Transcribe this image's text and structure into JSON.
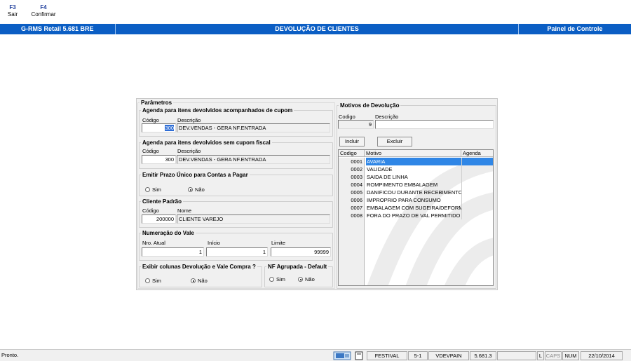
{
  "toolbar": {
    "f3": {
      "key": "F3",
      "label": "Sair"
    },
    "f4": {
      "key": "F4",
      "label": "Confirmar"
    }
  },
  "titlebar": {
    "app": "G-RMS Retail 5.681 BRE",
    "screen": "DEVOLUÇÃO DE CLIENTES",
    "panel": "Painel de Controle"
  },
  "params": {
    "title": "Parâmetros",
    "agenda_cupom": {
      "title": "Agenda para itens devolvidos acompanhados de cupom",
      "codigo_label": "Código",
      "descricao_label": "Descrição",
      "codigo": "300",
      "descricao": "DEV.VENDAS - GERA NF.ENTRADA"
    },
    "agenda_sem_cupom": {
      "title": "Agenda para itens devolvidos sem cupom fiscal",
      "codigo_label": "Código",
      "descricao_label": "Descrição",
      "codigo": "300",
      "descricao": "DEV.VENDAS - GERA NF.ENTRADA"
    },
    "prazo_unico": {
      "title": "Emitir Prazo Único para Contas a Pagar",
      "sim": "Sim",
      "nao": "Não",
      "selected": "nao"
    },
    "cliente_padrao": {
      "title": "Cliente Padrão",
      "codigo_label": "Código",
      "nome_label": "Nome",
      "codigo": "200000",
      "nome": "CLIENTE VAREJO"
    },
    "numeracao_vale": {
      "title": "Numeração do Vale",
      "atual_label": "Nro. Atual",
      "inicio_label": "Início",
      "limite_label": "Limite",
      "atual": "1",
      "inicio": "1",
      "limite": "99999"
    },
    "exibir_colunas": {
      "title": "Exibir colunas Devolução e Vale Compra ?",
      "sim": "Sim",
      "nao": "Não",
      "selected": "nao"
    },
    "nf_agrupada": {
      "title": "NF Agrupada - Default",
      "sim": "Sim",
      "nao": "Não",
      "selected": "nao"
    }
  },
  "motivos": {
    "title": "Motivos de Devolução",
    "codigo_label": "Codigo",
    "descricao_label": "Descrição",
    "codigo": "9",
    "descricao": "",
    "incluir": "Incluir",
    "excluir": "Excluir",
    "columns": [
      "Codigo",
      "Motivo",
      "Agenda"
    ],
    "rows": [
      {
        "codigo": "0001",
        "motivo": "AVARIA",
        "agenda": ""
      },
      {
        "codigo": "0002",
        "motivo": "VALIDADE",
        "agenda": ""
      },
      {
        "codigo": "0003",
        "motivo": "SAIDA DE LINHA",
        "agenda": ""
      },
      {
        "codigo": "0004",
        "motivo": "ROMPIMENTO EMBALAGEM",
        "agenda": ""
      },
      {
        "codigo": "0005",
        "motivo": "DANIFICOU DURANTE RECEBIMENTO",
        "agenda": ""
      },
      {
        "codigo": "0006",
        "motivo": "IMPROPRIO PARA CONSUMO",
        "agenda": ""
      },
      {
        "codigo": "0007",
        "motivo": "EMBALAGEM COM SUGEIRA/DEFORM",
        "agenda": ""
      },
      {
        "codigo": "0008",
        "motivo": "FORA DO PRAZO DE VAL PERMITIDO",
        "agenda": ""
      }
    ]
  },
  "statusbar": {
    "message": "Pronto.",
    "store": "FESTIVAL",
    "version_short": "5-1",
    "program": "VDEVPAIN",
    "version": "5.681.3",
    "blank": "",
    "l": "L",
    "caps": "CAPS",
    "num": "NUM",
    "date": "22/10/2014"
  },
  "colors": {
    "titlebar": "#0b5ec4",
    "selection": "#2f86e6"
  }
}
